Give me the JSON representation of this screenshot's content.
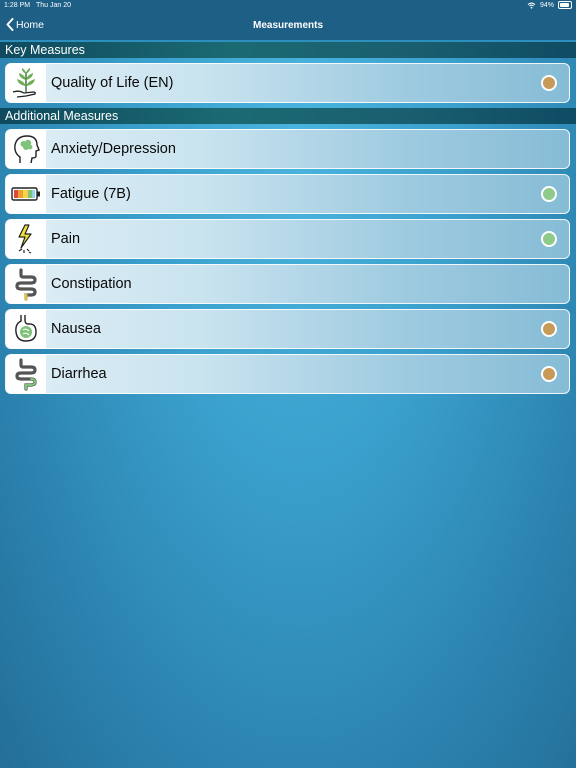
{
  "status_bar": {
    "time": "1:28 PM",
    "date": "Thu Jan 20",
    "battery": "94%"
  },
  "nav": {
    "back_label": "Home",
    "title": "Measurements"
  },
  "sections": {
    "key": "Key Measures",
    "additional": "Additional Measures"
  },
  "colors": {
    "status_orange": "#c79a58",
    "status_green": "#8fca8a",
    "header_bg": "#1e5f86"
  },
  "key_items": [
    {
      "label": "Quality of Life (EN)",
      "icon": "plant-hand-icon",
      "status": "orange"
    }
  ],
  "additional_items": [
    {
      "label": "Anxiety/Depression",
      "icon": "head-brain-icon",
      "status": "none"
    },
    {
      "label": "Fatigue (7B)",
      "icon": "battery-icon",
      "status": "green"
    },
    {
      "label": "Pain",
      "icon": "lightning-bolt-icon",
      "status": "green"
    },
    {
      "label": "Constipation",
      "icon": "intestine-icon",
      "status": "none"
    },
    {
      "label": "Nausea",
      "icon": "stomach-icon",
      "status": "orange"
    },
    {
      "label": "Diarrhea",
      "icon": "intestine-icon",
      "status": "orange"
    }
  ]
}
